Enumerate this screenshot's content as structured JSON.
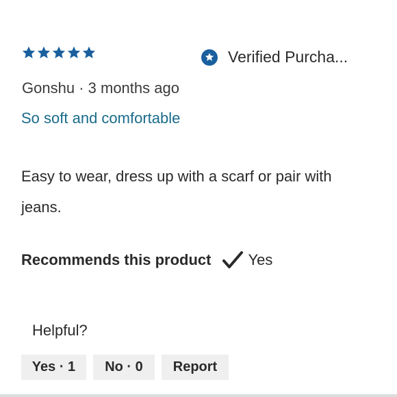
{
  "review": {
    "rating": 5,
    "rating_max": 5,
    "verified_label": "Verified Purcha...",
    "reviewer": "Gonshu",
    "separator": "·",
    "date": "3 months ago",
    "title": "So soft and comfortable",
    "body": "Easy to wear, dress up with a scarf or pair with jeans.",
    "recommends_label": "Recommends this product",
    "recommends_value": "Yes"
  },
  "helpful": {
    "label": "Helpful?",
    "yes_label": "Yes · 1",
    "no_label": "No · 0",
    "report_label": "Report"
  },
  "colors": {
    "star": "#1a5f9e",
    "accent_link": "#1a6b8a",
    "verified_icon": "#1a5f9e",
    "button_bg": "#efefef"
  },
  "icons": {
    "star": "star-icon",
    "verified": "verified-badge-icon",
    "check": "checkmark-icon"
  }
}
